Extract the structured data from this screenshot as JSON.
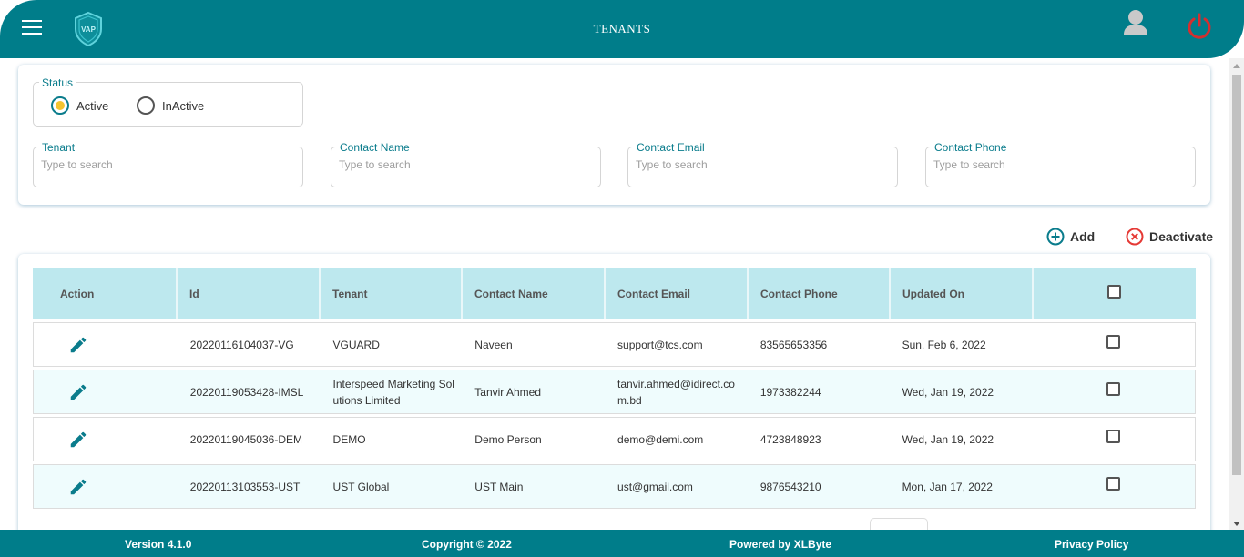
{
  "header": {
    "title": "TENANTS",
    "logo_text": "VAP",
    "brand_color": "#007d8a",
    "power_color": "#d32f2f"
  },
  "filters": {
    "status": {
      "legend": "Status",
      "options": [
        {
          "label": "Active",
          "selected": true
        },
        {
          "label": "InActive",
          "selected": false
        }
      ]
    },
    "fields": [
      {
        "label": "Tenant",
        "placeholder": "Type to search",
        "value": ""
      },
      {
        "label": "Contact Name",
        "placeholder": "Type to search",
        "value": ""
      },
      {
        "label": "Contact Email",
        "placeholder": "Type to search",
        "value": ""
      },
      {
        "label": "Contact Phone",
        "placeholder": "Type to search",
        "value": ""
      }
    ]
  },
  "actions": {
    "add_label": "Add",
    "deactivate_label": "Deactivate"
  },
  "table": {
    "columns": [
      "Action",
      "Id",
      "Tenant",
      "Contact Name",
      "Contact Email",
      "Contact Phone",
      "Updated On"
    ],
    "rows": [
      {
        "id": "20220116104037-VG",
        "tenant": "VGUARD",
        "contact_name": "Naveen",
        "contact_email": "support@tcs.com",
        "contact_phone": "83565653356",
        "updated_on": "Sun, Feb 6, 2022",
        "checked": false
      },
      {
        "id": "20220119053428-IMSL",
        "tenant": "Interspeed Marketing Solutions Limited",
        "contact_name": "Tanvir Ahmed",
        "contact_email": "tanvir.ahmed@idirect.com.bd",
        "contact_phone": "1973382244",
        "updated_on": "Wed, Jan 19, 2022",
        "checked": false
      },
      {
        "id": "20220119045036-DEM",
        "tenant": "DEMO",
        "contact_name": "Demo Person",
        "contact_email": "demo@demi.com",
        "contact_phone": "4723848923",
        "updated_on": "Wed, Jan 19, 2022",
        "checked": false
      },
      {
        "id": "20220113103553-UST",
        "tenant": "UST Global",
        "contact_name": "UST Main",
        "contact_email": "ust@gmail.com",
        "contact_phone": "9876543210",
        "updated_on": "Mon, Jan 17, 2022",
        "checked": false
      }
    ]
  },
  "footer": {
    "version": "Version 4.1.0",
    "copyright": "Copyright © 2022",
    "powered_by": "Powered by XLByte",
    "privacy": "Privacy Policy"
  },
  "icons": {
    "menu": "hamburger-menu-icon",
    "logo": "shield-logo-icon",
    "avatar": "user-avatar-icon",
    "power": "power-icon",
    "add": "plus-circle-icon",
    "deactivate": "x-circle-icon",
    "edit": "pencil-icon"
  }
}
